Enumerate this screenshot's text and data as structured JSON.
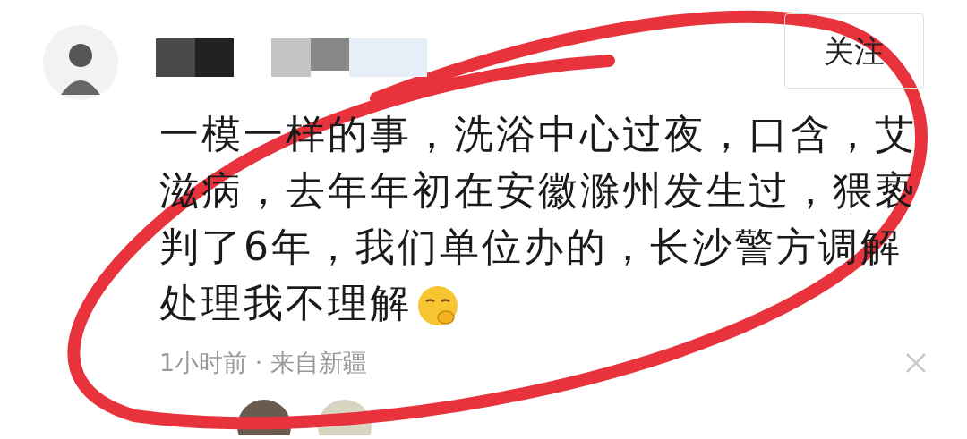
{
  "follow_button": {
    "label": "关注"
  },
  "comment": {
    "text": "一模一样的事，洗浴中心过夜，口含，艾滋病，去年年初在安徽滁州发生过，猥亵判了6年，我们单位办的，长沙警方调解处理我不理解",
    "meta": "1小时前 · 来自新疆"
  }
}
